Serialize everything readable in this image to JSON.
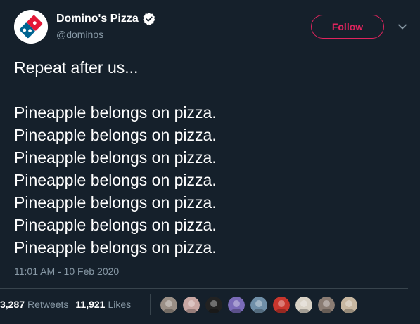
{
  "author": {
    "display_name": "Domino's Pizza",
    "handle": "@dominos",
    "verified": true,
    "avatar_icon": "dominos-logo-icon"
  },
  "actions": {
    "follow_label": "Follow",
    "more_icon": "chevron-down-icon"
  },
  "tweet": {
    "lines": [
      "Repeat after us...",
      "",
      "Pineapple belongs on pizza.",
      "Pineapple belongs on pizza.",
      "Pineapple belongs on pizza.",
      "Pineapple belongs on pizza.",
      "Pineapple belongs on pizza.",
      "Pineapple belongs on pizza.",
      "Pineapple belongs on pizza."
    ],
    "timestamp": "11:01 AM - 10 Feb 2020"
  },
  "stats": {
    "retweets_count": "3,287",
    "retweets_label": "Retweets",
    "likes_count": "11,921",
    "likes_label": "Likes"
  },
  "colors": {
    "background": "#15202b",
    "accent": "#e0245e",
    "secondary_text": "#8899a6",
    "divider": "#38444d"
  },
  "likers": [
    {
      "name": "liker-avatar-1",
      "color": "#9a8f86"
    },
    {
      "name": "liker-avatar-2",
      "color": "#c9a7a3"
    },
    {
      "name": "liker-avatar-3",
      "color": "#222222"
    },
    {
      "name": "liker-avatar-4",
      "color": "#7a6bb8"
    },
    {
      "name": "liker-avatar-5",
      "color": "#6f8fa8"
    },
    {
      "name": "liker-avatar-6",
      "color": "#c8362d"
    },
    {
      "name": "liker-avatar-7",
      "color": "#d9d2c6"
    },
    {
      "name": "liker-avatar-8",
      "color": "#8a7c73"
    },
    {
      "name": "liker-avatar-9",
      "color": "#c7b7a1"
    }
  ]
}
